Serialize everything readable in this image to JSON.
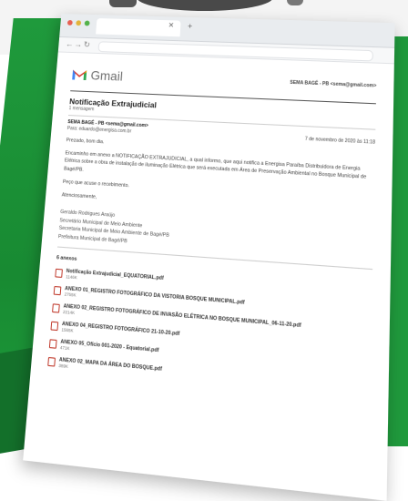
{
  "gmail": {
    "logo_text": "Gmail",
    "account": "SEMA BAGÉ - PB <sema@gmail.com>"
  },
  "email": {
    "subject": "Notificação Extrajudicial",
    "message_count": "1 mensagem",
    "from": "SEMA BAGÉ - PB <sema@gmail.com>",
    "to": "Para: eduardo@energisa.com.br",
    "date": "7 de novembro de 2020 às 11:18",
    "greeting": "Prezado, bom dia.",
    "body": "Encaminho em anexo a NOTIFICAÇÃO EXTRAJUDICIAL, a qual informo, que aqui notifica a Energisa Paraíba Distribuidora de Energia Elétrica sobre a obra de instalação de iluminação Elétrica que será executada em Área de Preservação Ambiental no Bosque Municipal de Bagé/PB.",
    "closing_request": "Peço que acuse o recebimento.",
    "regards": "Atenciosamente,",
    "signature": [
      "Geraldo Rodrigues Araújo",
      "Secretário Municipal de Meio Ambiente",
      "Secretaria Municipal de Meio Ambiente de Bagé/PB",
      "Prefeitura Municipal de Bagé/PB"
    ],
    "attachments_header": "6 anexos",
    "attachments": [
      {
        "name": "Notificação Extrajudicial_EQUATORIAL.pdf",
        "size": "1146K"
      },
      {
        "name": "ANEXO 01_REGISTRO FOTOGRÁFICO DA VISTORIA BOSQUE MUNICIPAL.pdf",
        "size": "2755K"
      },
      {
        "name": "ANEXO 02_REGISTRO FOTOGRÁFICO DE INVASÃO ELÉTRICA NO BOSQUE MUNICIPAL_06-11-20.pdf",
        "size": "2214K"
      },
      {
        "name": "ANEXO 04_REGISTRO FOTOGRÁFICO 21-10-20.pdf",
        "size": "1565K"
      },
      {
        "name": "ANEXO 05_Ofício 001-2020 - Equatorial.pdf",
        "size": "471K"
      },
      {
        "name": "ANEXO 02_MAPA DA ÁREA DO BOSQUE.pdf",
        "size": "389K"
      }
    ]
  },
  "colors": {
    "green": "#1f9a3c",
    "gmail_red": "#d93025"
  }
}
